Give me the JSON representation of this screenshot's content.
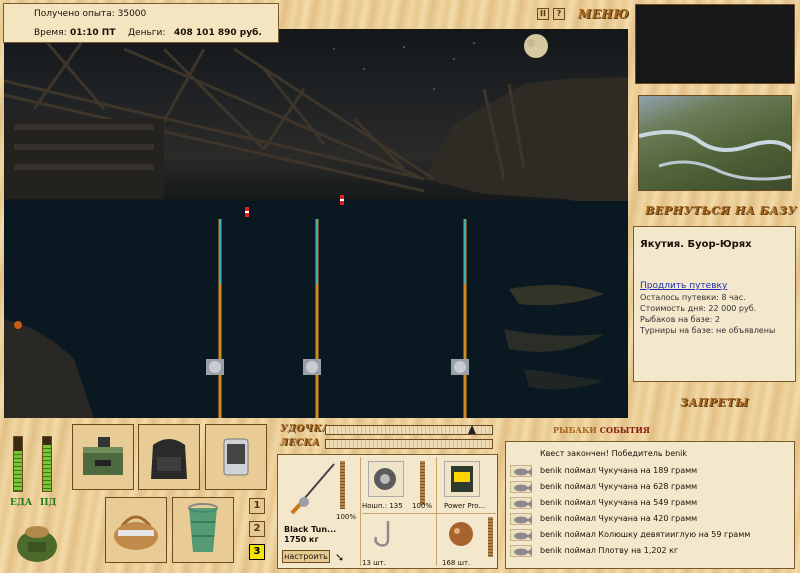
{
  "hud": {
    "exp_label": "Получено опыта:",
    "exp_value": "35000",
    "time_label": "Время:",
    "time_value": "01:10 ПТ",
    "money_label": "Деньги:",
    "money_value": "408 101 890 руб."
  },
  "topbar": {
    "pause_glyph": "II",
    "help_glyph": "?",
    "menu_label": "МЕНЮ"
  },
  "location": {
    "return_label": "ВЕРНУТЬСЯ НА БАЗУ",
    "title": "Якутия. Буор-Юрях",
    "extend_link": "Продлить путевку",
    "remaining": "Осталось путевки: 8 час.",
    "cost": "Стоимость дня: 22 000 руб.",
    "fishers": "Рыбаков на базе: 2",
    "tournaments": "Турниры на базе: не объявлены",
    "bans_label": "ЗАПРЕТЫ"
  },
  "gauges": {
    "food_label": "ЕДА",
    "food_level": 0.75,
    "bait_label": "ПД",
    "bait_level": 0.85
  },
  "tackle": {
    "rod_label": "УДОЧКА",
    "line_label": "ЛЕСКА",
    "rod_name": "Black Tun...",
    "rod_capacity": "1750 кг",
    "rod_condition": "100%",
    "reel_name": "Ношп.: 135",
    "reel_condition": "100%",
    "bait_name": "Power Pro...",
    "hook_count": "13 шт.",
    "lure_count": "168 шт.",
    "setup_button": "настроить",
    "slots": [
      "1",
      "2",
      "3"
    ],
    "active_slot": "3"
  },
  "feed": {
    "title_part1": "РЫБАКИ",
    "title_part2": "СОБЫТИЯ",
    "header": "Квест закончен! Победитель benik",
    "entries": [
      "benik поймал Чукучана на 189 грамм",
      "benik поймал Чукучана на 628 грамм",
      "benik поймал Чукучана на 549 грамм",
      "benik поймал Чукучана на 420 грамм",
      "benik поймал Колюшку девятииглую на 59 грамм",
      "benik поймал Плотву на 1,202 кг"
    ]
  },
  "colors": {
    "link": "#1f2fb0",
    "accent": "#8a1a10",
    "active_slot": "#f6e400"
  }
}
